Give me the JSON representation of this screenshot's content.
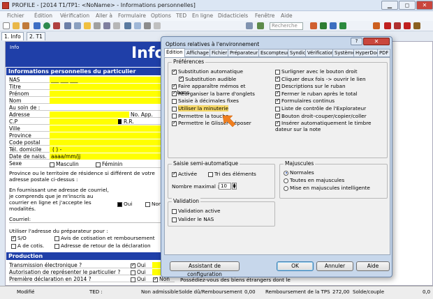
{
  "window": {
    "title": "PROFILE - [2014 T1/TP1: <NoName> - Informations personnelles]",
    "min": "▁",
    "max": "◻",
    "close": "✕"
  },
  "menu": [
    "Fichier",
    "Édition",
    "Vérification",
    "Aller à",
    "Formulaire",
    "Options",
    "TED",
    "En ligne",
    "Didacticiels",
    "Fenêtre",
    "Aide"
  ],
  "toolbar": {
    "search_placeholder": "Recherche"
  },
  "tabs": [
    {
      "label": "1. Info"
    },
    {
      "label": "2. T1"
    }
  ],
  "form": {
    "banner_left": "Info",
    "banner_title": "Infor",
    "section1": "Informations personnelles du particulier",
    "rows": [
      "NAS",
      "Titre",
      "Prénom",
      "Nom",
      "Au soin de :",
      "Adresse",
      "C.P",
      "Ville",
      "Province",
      "Code postal",
      "Tél. domicile",
      "Date de naiss.",
      "Sexe"
    ],
    "nas_value": "___ ___ ___",
    "no_app": "No. App.",
    "rr": "R.R.",
    "tel_value": "(     )     -",
    "date_value": "aaaa/mm/jj",
    "sex_m": "Masculin",
    "sex_f": "Féminin",
    "province_text": "Province ou le territoire de résidence si différent de votre adresse postale ci-dessus :",
    "email_text": "En fournissant une adresse de courriel, je comprends que je m'inscris au courrier en ligne et j'accepte les modalités.",
    "oui": "Oui",
    "non": "Non",
    "courriel": "Courriel:",
    "prep_text": "Utiliser l'adresse du préparateur pour :",
    "so": "S/O",
    "avis": "Avis de cotisation et remboursement",
    "a_cotis": "A  de cotis.",
    "retour": "Adresse de retour de la déclaration",
    "section2": "Production",
    "prod_rows": [
      "Transmission électronique ?",
      "Autorisation de représenter le particulier ?",
      "Première déclaration en 2014 ?"
    ],
    "biens": "Possédiez-vous des biens étrangers dont le"
  },
  "status": {
    "mode": "Modifié",
    "ted": "TED :",
    "non_adm": "Non admissible",
    "solde_label": "Solde dû/Remboursement",
    "solde_val": "0,00",
    "tps_label": "Remboursement de la TPS",
    "tps_val": "272,00",
    "couple": "Solde/couple",
    "couple_val": "0,0"
  },
  "dialog": {
    "title": "Options relatives à l'environnement",
    "help": "?",
    "close": "✕",
    "tabs": [
      "Édition",
      "Affichage",
      "Fichier",
      "Préparateur",
      "Escompteur",
      "Syndic",
      "Vérification",
      "Système",
      "HyperDocs",
      "PDF"
    ],
    "pref_label": "Préférences",
    "left_opts": [
      {
        "label": "Substitution automatique",
        "checked": true
      },
      {
        "label": "Substitution audible",
        "checked": true
      },
      {
        "label": "Faire apparaître mémos et rubans",
        "checked": true
      },
      {
        "label": "Réorganiser la barre d'onglets",
        "checked": true
      },
      {
        "label": "Saisie à décimales fixes",
        "checked": false
      },
      {
        "label": "Utiliser la minuterie",
        "checked": false
      },
      {
        "label": "Permettre la touche",
        "checked": false
      },
      {
        "label": "Permettre le Glisser-Déposer",
        "checked": true
      }
    ],
    "right_opts": [
      {
        "label": "Surligner avec le bouton droit",
        "checked": false
      },
      {
        "label": "Cliquer deux fois -> ouvrir le lien",
        "checked": true
      },
      {
        "label": "Descriptions sur le ruban",
        "checked": true
      },
      {
        "label": "Fermer le ruban après le total",
        "checked": true
      },
      {
        "label": "Formulaires continus",
        "checked": true
      },
      {
        "label": "Liste de contrôle de l'Explorateur",
        "checked": false
      },
      {
        "label": "Bouton droit–couper/copier/coller",
        "checked": true
      },
      {
        "label": "Insérer automatiquement le timbre dateur sur la note",
        "checked": true
      }
    ],
    "semi_label": "Saisie semi-automatique",
    "active": "Activée",
    "tri": "Tri des éléments",
    "nmax_label": "Nombre maximal :",
    "nmax_value": "10",
    "maj_label": "Majuscules",
    "maj_opts": [
      {
        "label": "Normales",
        "selected": true
      },
      {
        "label": "Toutes en majuscules",
        "selected": false
      },
      {
        "label": "Mise en majuscules intelligente",
        "selected": false
      }
    ],
    "valid_label": "Validation",
    "valid_opts": [
      {
        "label": "Validation active",
        "checked": false
      },
      {
        "label": "Valider le NAS",
        "checked": false
      }
    ],
    "assistant": "Assistant de configuration",
    "ok": "OK",
    "cancel": "Annuler",
    "aide": "Aide"
  },
  "accent": "#f07f1f"
}
